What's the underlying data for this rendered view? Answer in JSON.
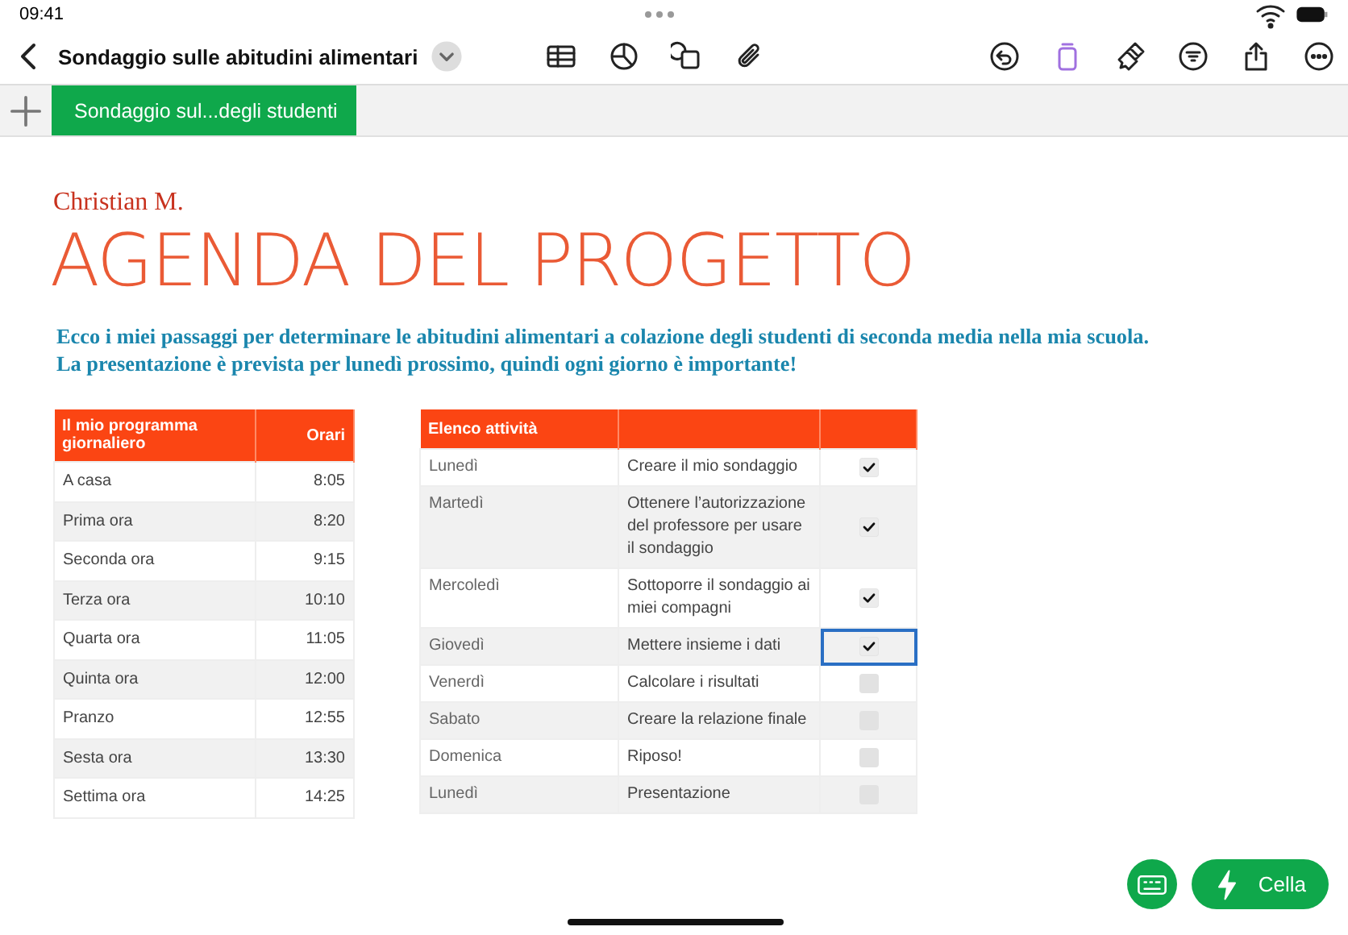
{
  "status_bar": {
    "time": "09:41"
  },
  "toolbar": {
    "title": "Sondaggio sulle abitudini alimentari"
  },
  "sheet_tabs": [
    {
      "label": "Sondaggio sul...degli studenti",
      "selected": true
    }
  ],
  "author": "Christian M.",
  "heading": "AGENDA DEL PROGETTO",
  "intro": [
    "Ecco i miei passaggi per determinare le abitudini alimentari a colazione degli studenti di seconda media nella mia scuola.",
    "La presentazione è prevista per lunedì prossimo, quindi ogni giorno è importante!"
  ],
  "schedule": {
    "columns": [
      "Il mio programma giornaliero",
      "Orari"
    ],
    "rows": [
      {
        "period": "A casa",
        "time": "8:05"
      },
      {
        "period": "Prima ora",
        "time": "8:20"
      },
      {
        "period": "Seconda ora",
        "time": "9:15"
      },
      {
        "period": "Terza ora",
        "time": "10:10"
      },
      {
        "period": "Quarta ora",
        "time": "11:05"
      },
      {
        "period": "Quinta ora",
        "time": "12:00"
      },
      {
        "period": "Pranzo",
        "time": "12:55"
      },
      {
        "period": "Sesta ora",
        "time": "13:30"
      },
      {
        "period": "Settima ora",
        "time": "14:25"
      }
    ]
  },
  "tasks": {
    "columns": [
      "Elenco attività"
    ],
    "rows": [
      {
        "day": "Lunedì",
        "task": "Creare il mio sondaggio",
        "checked": true,
        "selected": false
      },
      {
        "day": "Martedì",
        "task": "Ottenere l’autorizzazione del professore per usare il sondaggio",
        "checked": true,
        "selected": false
      },
      {
        "day": "Mercoledì",
        "task": "Sottoporre il sondaggio ai miei compagni",
        "checked": true,
        "selected": false
      },
      {
        "day": "Giovedì",
        "task": "Mettere insieme i dati",
        "checked": true,
        "selected": true
      },
      {
        "day": "Venerdì",
        "task": "Calcolare i risultati",
        "checked": false,
        "selected": false
      },
      {
        "day": "Sabato",
        "task": "Creare la relazione finale",
        "checked": false,
        "selected": false
      },
      {
        "day": "Domenica",
        "task": "Riposo!",
        "checked": false,
        "selected": false
      },
      {
        "day": "Lunedì",
        "task": "Presentazione",
        "checked": false,
        "selected": false
      }
    ]
  },
  "cell_button": {
    "label": "Cella"
  }
}
